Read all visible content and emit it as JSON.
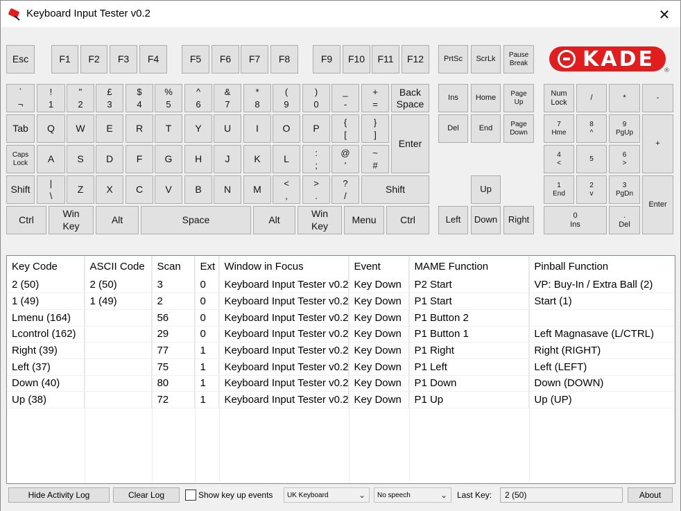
{
  "window": {
    "title": "Keyboard Input Tester v0.2",
    "close_glyph": "✕"
  },
  "logo": {
    "text": "KADE",
    "reg": "®"
  },
  "keys": {
    "esc": "Esc",
    "f1": "F1",
    "f2": "F2",
    "f3": "F3",
    "f4": "F4",
    "f5": "F5",
    "f6": "F6",
    "f7": "F7",
    "f8": "F8",
    "f9": "F9",
    "f10": "F10",
    "f11": "F11",
    "f12": "F12",
    "prtsc": "PrtSc",
    "scrlk": "ScrLk",
    "pause": "Pause\nBreak",
    "backtick": "`\n¬",
    "n1": "!\n1",
    "n2": "\"\n2",
    "n3": "£\n3",
    "n4": "$\n4",
    "n5": "%\n5",
    "n6": "^\n6",
    "n7": "&\n7",
    "n8": "*\n8",
    "n9": "(\n9",
    "n0": ")\n0",
    "minus": "_\n-",
    "equals": "+\n=",
    "backspace": "Back\nSpace",
    "ins": "Ins",
    "home": "Home",
    "pgup": "Page\nUp",
    "numlock": "Num\nLock",
    "np_div": "/",
    "np_mul": "*",
    "np_sub": "-",
    "tab": "Tab",
    "q": "Q",
    "w": "W",
    "e": "E",
    "r": "R",
    "t": "T",
    "y": "Y",
    "u": "U",
    "i": "I",
    "o": "O",
    "p": "P",
    "lbrace": "{\n[",
    "rbrace": "}\n]",
    "enter": "Enter",
    "del": "Del",
    "end": "End",
    "pgdn": "Page\nDown",
    "np7": "7\nHme",
    "np8": "8\n^",
    "np9": "9\nPgUp",
    "np_add": "+",
    "caps": "Caps\nLock",
    "a": "A",
    "s": "S",
    "d": "D",
    "f": "F",
    "g": "G",
    "h": "H",
    "j": "J",
    "k": "K",
    "l": "L",
    "semicolon": ":\n;",
    "quote": "@\n'",
    "hash": "~\n#",
    "np4": "4\n<",
    "np5": "5",
    "np6": "6\n>",
    "lshift": "Shift",
    "backslash": "|\n\\",
    "z": "Z",
    "x": "X",
    "c": "C",
    "v": "V",
    "b": "B",
    "n": "N",
    "m": "M",
    "comma": "<\n,",
    "period": ">\n.",
    "slash": "?\n/",
    "rshift": "Shift",
    "up": "Up",
    "np1": "1\nEnd",
    "np2": "2\nv",
    "np3": "3\nPgDn",
    "np_enter": "Enter",
    "lctrl": "Ctrl",
    "lwin": "Win\nKey",
    "lalt": "Alt",
    "space": "Space",
    "ralt": "Alt",
    "rwin": "Win\nKey",
    "menu": "Menu",
    "rctrl": "Ctrl",
    "left": "Left",
    "down": "Down",
    "right": "Right",
    "np0": "0\nIns",
    "np_dot": ".\nDel"
  },
  "log": {
    "headers": [
      "Key Code",
      "ASCII Code",
      "Scan",
      "Ext",
      "Window in Focus",
      "Event",
      "MAME Function",
      "Pinball Function"
    ],
    "rows": [
      [
        "2 (50)",
        "2 (50)",
        "3",
        "0",
        "Keyboard Input Tester v0.2",
        "Key Down",
        "P2 Start",
        "VP: Buy-In / Extra Ball (2)"
      ],
      [
        "1 (49)",
        "1 (49)",
        "2",
        "0",
        "Keyboard Input Tester v0.2",
        "Key Down",
        "P1 Start",
        "Start (1)"
      ],
      [
        "Lmenu (164)",
        "",
        "56",
        "0",
        "Keyboard Input Tester v0.2",
        "Key Down",
        "P1 Button 2",
        ""
      ],
      [
        "Lcontrol (162)",
        "",
        "29",
        "0",
        "Keyboard Input Tester v0.2",
        "Key Down",
        "P1 Button 1",
        "Left Magnasave (L/CTRL)"
      ],
      [
        "Right (39)",
        "",
        "77",
        "1",
        "Keyboard Input Tester v0.2",
        "Key Down",
        "P1 Right",
        "Right (RIGHT)"
      ],
      [
        "Left (37)",
        "",
        "75",
        "1",
        "Keyboard Input Tester v0.2",
        "Key Down",
        "P1 Left",
        "Left (LEFT)"
      ],
      [
        "Down (40)",
        "",
        "80",
        "1",
        "Keyboard Input Tester v0.2",
        "Key Down",
        "P1 Down",
        "Down (DOWN)"
      ],
      [
        "Up (38)",
        "",
        "72",
        "1",
        "Keyboard Input Tester v0.2",
        "Key Down",
        "P1 Up",
        "Up (UP)"
      ]
    ]
  },
  "footer": {
    "hide_log": "Hide Activity Log",
    "clear_log": "Clear Log",
    "show_keyup": "Show key up events",
    "keyboard_select": "UK Keyboard",
    "speech_select": "No speech",
    "last_key_label": "Last Key:",
    "last_key_value": "2 (50)",
    "about": "About"
  },
  "colors": {
    "accent": "#e11d1d",
    "key_face": "#e1e1e1",
    "window_bg": "#f0f0f0"
  }
}
